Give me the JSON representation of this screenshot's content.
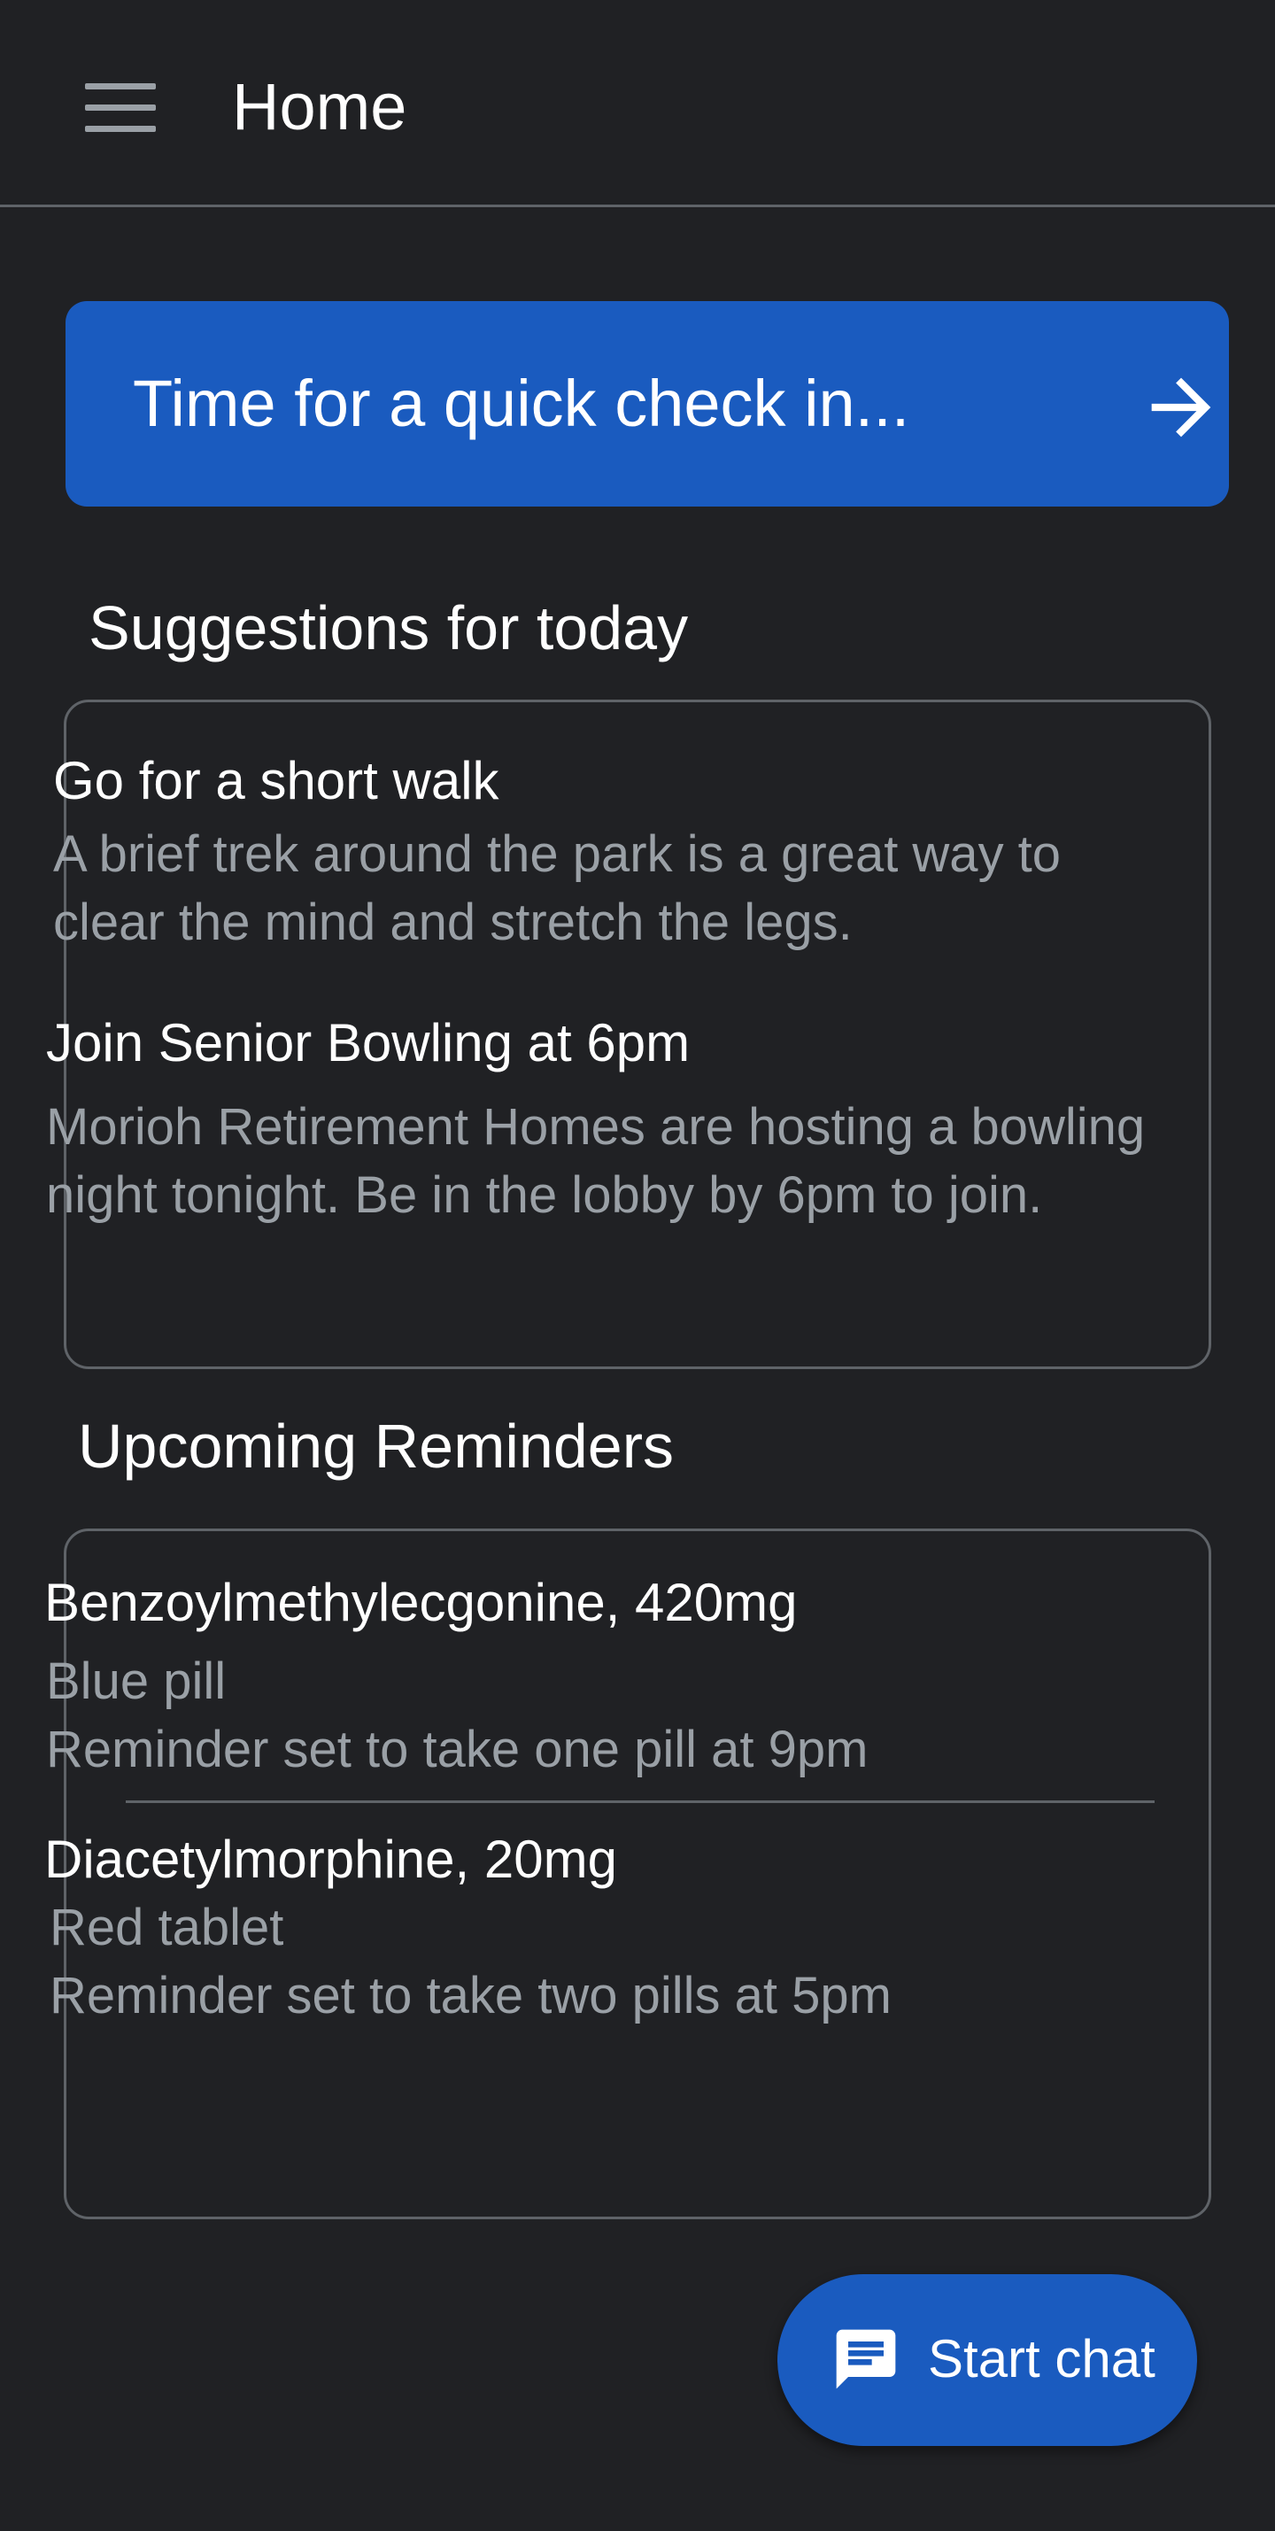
{
  "app_bar": {
    "title": "Home",
    "menu_icon": "hamburger-menu-icon"
  },
  "checkin_banner": {
    "label": "Time for a quick check in...",
    "icon": "arrow-forward-icon"
  },
  "suggestions": {
    "title": "Suggestions for today",
    "items": [
      {
        "title": "Go for a short walk",
        "body": "A brief trek around the park is a great way to clear the mind and stretch the legs."
      },
      {
        "title": "Join Senior Bowling at 6pm",
        "body": "Morioh Retirement Homes are hosting a bowling night tonight. Be in the lobby by 6pm to join."
      }
    ]
  },
  "reminders": {
    "title": "Upcoming Reminders",
    "items": [
      {
        "title": "Benzoylmethylecgonine, 420mg",
        "description": "Blue pill",
        "schedule": "Reminder set to take one pill at 9pm"
      },
      {
        "title": "Diacetylmorphine, 20mg",
        "description": "Red tablet",
        "schedule": "Reminder set to take two pills at 5pm"
      }
    ]
  },
  "fab": {
    "label": "Start chat",
    "icon": "chat-icon"
  },
  "colors": {
    "background": "#202124",
    "accent": "#1a5bbf",
    "secondary_text": "#9aa0a6",
    "outline": "#5f6368"
  }
}
